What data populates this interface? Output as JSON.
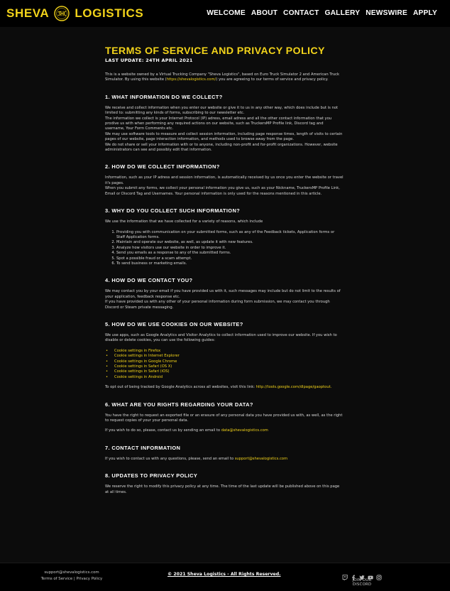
{
  "header": {
    "logo_left": "SHEVA",
    "logo_right": "LOGISTICS",
    "nav": [
      "WELCOME",
      "ABOUT",
      "CONTACT",
      "GALLERY",
      "NEWSWIRE",
      "APPLY"
    ]
  },
  "page": {
    "title": "TERMS OF SERVICE AND PRIVACY POLICY",
    "last_update": "LAST UPDATE: 24TH APRIL 2021",
    "intro_before": "This is a website owned by a Virtual Trucking Company \"Sheva Logistics\", based on Euro Truck Simulator 2 and American Truck Simulator. By using this website (",
    "intro_link": "https://shevalogistics.com/",
    "intro_after": ") you are agreeing to our terms of service and privacy policy."
  },
  "sections": [
    {
      "heading": "1. WHAT INFORMATION DO WE COLLECT?",
      "paragraphs": [
        "We receive and collect information when you enter our website or give it to us in any other way, which does include but is not limited to: submitting any kinds of forms, subscribing to our newsletter etc.",
        "The information we collect is your Internet Protocol (IP) adress, email adress and all the other contact information that you prodive us with when performing any required actions on our website, such as TruckersMP Profile link, Discord tag and username, Your Form Comments etc.",
        "We may use software tools to measure and collect session information, including page response times, length of visits to certain pages of our website, page interaction information, and methods used to browse away from the page.",
        "We do not share or sell your information with or to anyone, including non-profit and for-profit organizations. However, website administrators can see and possibly edit that information."
      ]
    },
    {
      "heading": "2. HOW DO WE COLLECT INFORMATION?",
      "paragraphs": [
        "Information, such as your IP adress and session information, is automatically received by us once you enter the website or travel it's pages.",
        "When you submit any forms, we collect your personal information you give us, such as your Nickname, TruckersMP Profile Link, Email or Discord Tag and Usernames. Your personal information is only used for the reasons mentioned in this article."
      ]
    },
    {
      "heading": "3. WHY DO YOU COLLECT SUCH INFORMATION?",
      "paragraphs": [
        "We use the information that we have collected for a variety of reasons, which include"
      ],
      "items": [
        "Providing you with communication on your submitted forms, such as any of the Feedback tickets, Application forms or Staff Application forms.",
        "Maintain and operate our website, as well, as update it with new features.",
        "Analyze how visitors use our website in order to improve it.",
        "Send you emails as a response to any of the submitted forms.",
        "Spot a possible fraud or a scam attempt.",
        "To send business or marketing emails."
      ]
    },
    {
      "heading": "4. HOW DO WE CONTACT YOU?",
      "paragraphs": [
        "We may contact you by your email if you have provided us with it, such messages may include but do not limit to the results of your application, feedback response etc.",
        "If you have provided us with any other of your personal information during form submission, we may contact you through Discord or Steam private messaging."
      ]
    },
    {
      "heading": "5. HOW DO WE USE COOKIES ON OUR WEBSITE?",
      "paragraphs": [
        "We use apps, such as Google Analytics and Visitor Analytics to collect information used to improve our website. If you wish to disable or delete cookies, you can use the following guides:"
      ],
      "cookie_links": [
        "Cookie settings in Firefox",
        "Cookie settings in Internet Explorer",
        "Cookie settings in Google Chrome",
        "Cookie settings in Safari (OS X)",
        "Cookie settings in Safari (iOS)",
        "Cookie settings in Android"
      ],
      "optout_text": "To opt out of being tracked by Google Analytics across all websites, visit this link:",
      "optout_link": "http://tools.google.com/dlpage/gaoptout."
    },
    {
      "heading": "6. WHAT ARE YOU RIGHTS REGARDING YOUR DATA?",
      "paragraphs": [
        "You have the right to request an exported file or an erasure of any personal data you have provided us with, as well, as the right to request copies of your your personal data."
      ],
      "contact_text": "If you wish to do so, please, contact us by sending an email to",
      "contact_email": "data@shevalogistics.com"
    },
    {
      "heading": "7. CONTACT INFORMATION",
      "contact_text": "If you wish to contact us with any questions, please, send an email to",
      "contact_email": "support@shevalogistics.com"
    },
    {
      "heading": "8. UPDATES TO PRIVACY POLICY",
      "paragraphs": [
        "We reserve the right to modify this privacy policy at any time. The time of the last update will be published above on this page at all times."
      ]
    }
  ],
  "footer": {
    "email": "support@shevalogistics.com",
    "terms_link": "Terms of Service",
    "separator": "|",
    "privacy_link": "Privacy Policy",
    "copyright": "© 2021 Sheva Logistics - All Rights Reserved.",
    "social_icons": [
      "twitch-icon",
      "facebook-icon",
      "twitter-icon",
      "youtube-icon",
      "instagram-icon"
    ],
    "join_discord": "JOIN OUR DISCORD"
  },
  "colors": {
    "accent": "#f2d31a",
    "background": "#0c0c0c",
    "header_bg": "#000000"
  }
}
